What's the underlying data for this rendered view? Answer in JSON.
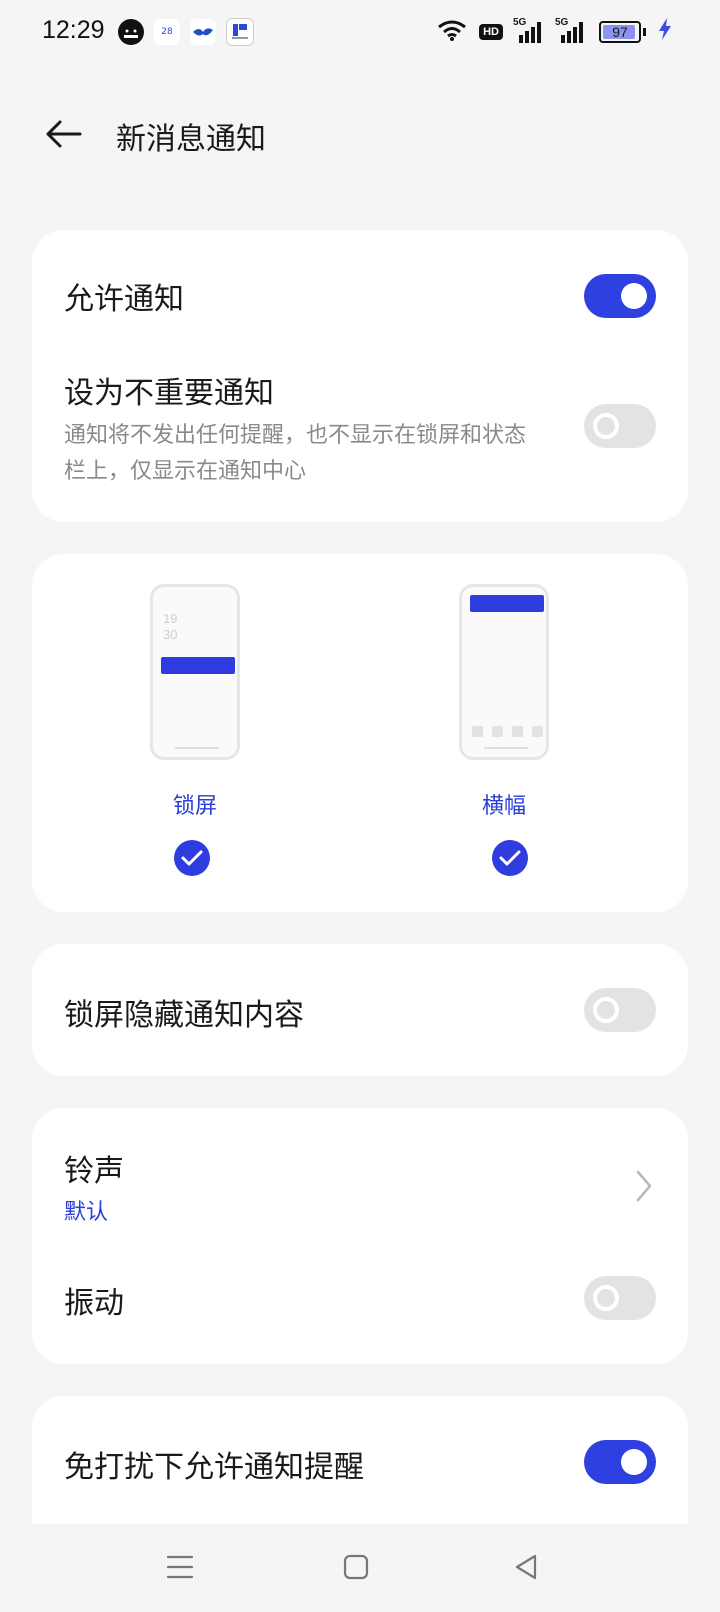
{
  "status_bar": {
    "time": "12:29",
    "app_icons": [
      "cat-app-icon",
      "calendar-icon",
      "bird-app-icon",
      "ir-app-icon"
    ],
    "calendar_day": "28",
    "hd_label": "HD",
    "signal_labels": [
      "5G",
      "5G"
    ],
    "battery": "97",
    "battery_fraction": 0.97,
    "charging": true
  },
  "header": {
    "title": "新消息通知",
    "back_icon": "back-arrow-icon"
  },
  "allow_card": {
    "allow_label": "允许通知",
    "allow_on": true,
    "unimportant_label": "设为不重要通知",
    "unimportant_desc": "通知将不发出任何提醒，也不显示在锁屏和状态栏上，仅显示在通知中心",
    "unimportant_on": false
  },
  "style_card": {
    "lockscreen_clock": "19\n30",
    "lockscreen_label": "锁屏",
    "lockscreen_checked": true,
    "banner_label": "横幅",
    "banner_checked": true
  },
  "hide_card": {
    "label": "锁屏隐藏通知内容",
    "on": false
  },
  "sound_card": {
    "ringtone_label": "铃声",
    "ringtone_value": "默认",
    "vibrate_label": "振动",
    "vibrate_on": false
  },
  "dnd_card": {
    "label": "免打扰下允许通知提醒",
    "on": true
  },
  "nav_bar": {
    "icons": [
      "menu-icon",
      "home-icon",
      "back-icon"
    ]
  },
  "colors": {
    "accent": "#2f40e0",
    "accent_text": "#2a3fd6",
    "background": "#f5f5f5",
    "toggle_off": "#e3e3e3"
  }
}
